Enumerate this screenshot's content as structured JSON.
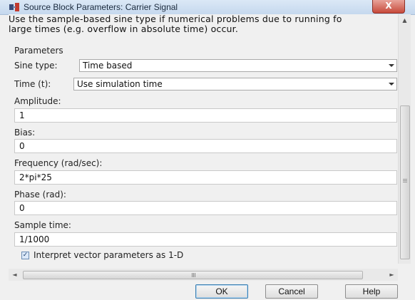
{
  "window": {
    "title": "Source Block Parameters: Carrier Signal",
    "close_label": "X"
  },
  "description": {
    "line1": "Use the sample-based sine type if numerical problems due to running fo",
    "line2": "large times (e.g. overflow in absolute time) occur."
  },
  "parameters": {
    "section_label": "Parameters",
    "sine_type": {
      "label": "Sine type:",
      "value": "Time based"
    },
    "time": {
      "label": "Time (t):",
      "value": "Use simulation time"
    },
    "amplitude": {
      "label": "Amplitude:",
      "value": "1"
    },
    "bias": {
      "label": "Bias:",
      "value": "0"
    },
    "frequency": {
      "label": "Frequency (rad/sec):",
      "value": "2*pi*25"
    },
    "phase": {
      "label": "Phase (rad):",
      "value": "0"
    },
    "sample_time": {
      "label": "Sample time:",
      "value": "1/1000"
    },
    "interpret_vector": {
      "label": "Interpret vector parameters as 1-D",
      "checked": true,
      "check_mark": "✓"
    }
  },
  "scrollbars": {
    "up_arrow": "▲",
    "left_arrow": "◄",
    "right_arrow": "►"
  },
  "buttons": {
    "ok": "OK",
    "cancel": "Cancel",
    "help": "Help"
  }
}
